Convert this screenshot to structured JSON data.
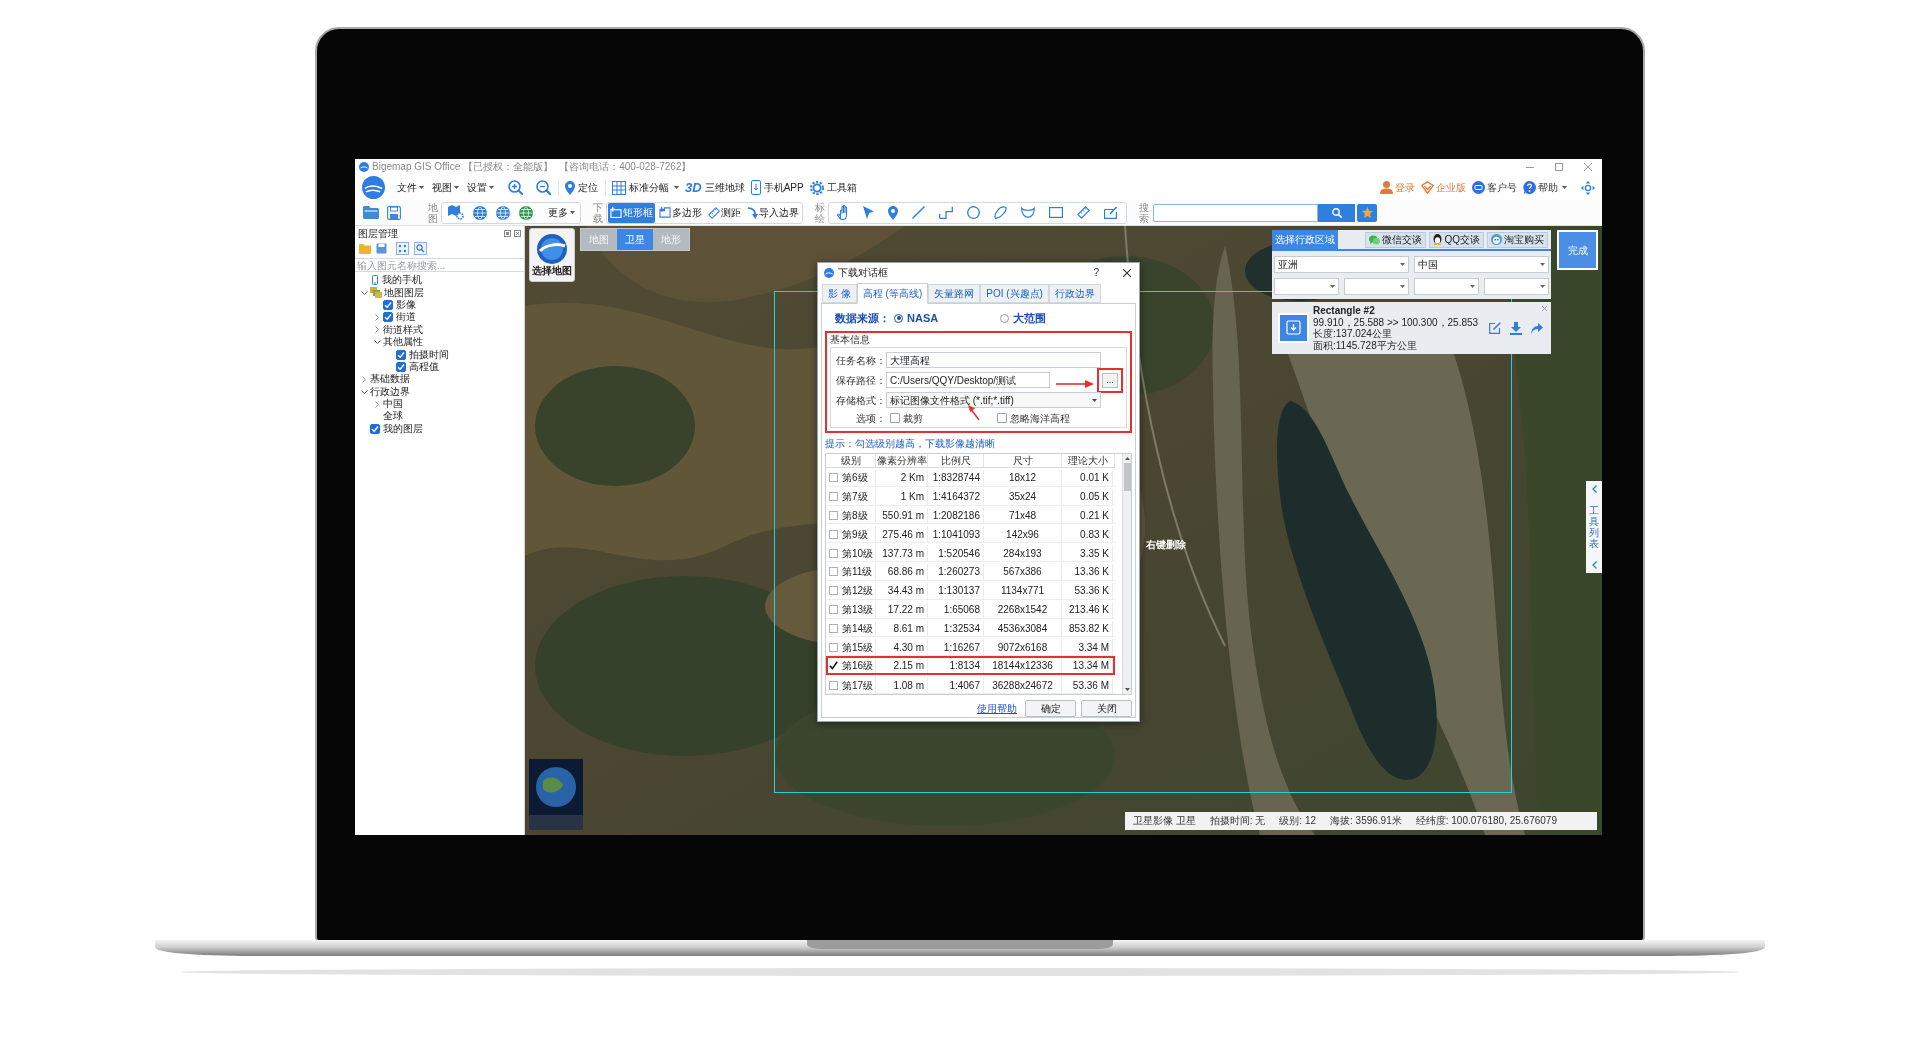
{
  "window": {
    "title": "Bigemap GIS Office",
    "license": "【已授权：全能版】",
    "hotline": "【咨询电话：400-028-7262】"
  },
  "menu_bar": {
    "menus": [
      {
        "label": "文件",
        "dropdown": true
      },
      {
        "label": "视图",
        "dropdown": true
      },
      {
        "label": "设置",
        "dropdown": true
      }
    ],
    "tools": [
      {
        "label": "定位",
        "dropdown": false
      },
      {
        "label": "标准分幅",
        "dropdown": true
      },
      {
        "label": "三维地球",
        "dropdown": false,
        "icon_text": "3D"
      },
      {
        "label": "手机APP",
        "dropdown": false
      },
      {
        "label": "工具箱",
        "dropdown": false
      }
    ],
    "account": [
      {
        "label": "登录",
        "dropdown": false,
        "kind": "accent"
      },
      {
        "label": "企业版",
        "dropdown": false,
        "kind": "accent"
      },
      {
        "label": "客户号",
        "dropdown": false,
        "kind": "plain"
      },
      {
        "label": "帮助",
        "dropdown": true,
        "kind": "plain"
      }
    ]
  },
  "toolbar": {
    "map_group": {
      "label": "地图",
      "more": {
        "label": "更多",
        "dropdown": true
      }
    },
    "download_group": {
      "label": "下载",
      "tools": [
        {
          "label": "矩形框",
          "selected": true
        },
        {
          "label": "多边形",
          "selected": false
        },
        {
          "label": "测距",
          "selected": false
        },
        {
          "label": "导入边界",
          "selected": false
        }
      ]
    },
    "draw_group": {
      "label": "标绘"
    },
    "search_group": {
      "label": "搜索"
    }
  },
  "layer_panel": {
    "title": "图层管理",
    "search": {
      "placeholder": "输入图元名称搜索..."
    },
    "tree": [
      {
        "label": "我的手机",
        "kind": "device"
      },
      {
        "label": "地图图层",
        "kind": "layers",
        "expanded": true,
        "children": [
          {
            "label": "影像",
            "kind": "checkable",
            "checked": true
          },
          {
            "label": "街道",
            "kind": "checkable",
            "checked": true,
            "expanded": false
          },
          {
            "label": "街道样式",
            "kind": "plain",
            "expanded": false
          },
          {
            "label": "其他属性",
            "kind": "plain",
            "expanded": true,
            "children": [
              {
                "label": "拍摄时间",
                "kind": "checkable",
                "checked": true
              },
              {
                "label": "高程值",
                "kind": "checkable",
                "checked": true
              }
            ]
          }
        ]
      },
      {
        "label": "基础数据",
        "kind": "plain",
        "expanded": false
      },
      {
        "label": "行政边界",
        "kind": "plain",
        "expanded": true,
        "children": [
          {
            "label": "中国",
            "kind": "plain",
            "expanded": false
          },
          {
            "label": "全球",
            "kind": "plain"
          }
        ]
      },
      {
        "label": "我的图层",
        "kind": "checkable",
        "checked": true
      }
    ]
  },
  "map": {
    "view_tabs": [
      {
        "label": "地图",
        "selected": false
      },
      {
        "label": "卫星",
        "selected": true
      },
      {
        "label": "地形",
        "selected": false
      }
    ],
    "map_picker": "选择地图",
    "hint": "右键删除",
    "side_tab": "工具列表",
    "region_panel": {
      "tab": "选择行政区域",
      "contacts": [
        "微信交谈",
        "QQ交谈",
        "淘宝购买"
      ],
      "selects": [
        "亚洲",
        "中国"
      ]
    },
    "shape_card": {
      "title": "Rectangle #2",
      "coords": "99.910，25.588 >> 100.300，25.853",
      "length": "长度:137.024公里",
      "area": "面积:1145.728平方公里"
    },
    "done_button": "完成",
    "status_bar": [
      "卫星影像 卫星",
      "拍摄时间: 无",
      "级别: 12",
      "海拔: 3596.91米",
      "经纬度: 100.076180, 25.676079"
    ]
  },
  "download_dialog": {
    "title": "下载对话框",
    "help": "?",
    "tabs": [
      {
        "label": "影 像",
        "selected": false
      },
      {
        "label": "高程 (等高线)",
        "selected": true
      },
      {
        "label": "矢量路网",
        "selected": false
      },
      {
        "label": "POI (兴趣点)",
        "selected": false
      },
      {
        "label": "行政边界",
        "selected": false
      }
    ],
    "source": {
      "label": "数据来源：",
      "options": [
        {
          "label": "NASA",
          "selected": true
        },
        {
          "label": "大范围",
          "selected": false
        }
      ]
    },
    "basic_info": {
      "title": "基本信息",
      "highlighted": true,
      "fields": [
        {
          "kind": "text",
          "label": "任务名称：",
          "value": "大理高程"
        },
        {
          "kind": "path",
          "label": "保存路径：",
          "value": "C:/Users/QQY/Desktop/测试",
          "button": "...",
          "highlighted": true
        },
        {
          "kind": "select",
          "label": "存储格式：",
          "value": "标记图像文件格式 (*.tif;*.tiff)"
        }
      ],
      "options_label": "选项：",
      "options": [
        {
          "label": "裁剪",
          "checked": false
        },
        {
          "label": "忽略海洋高程",
          "checked": false
        }
      ]
    },
    "tip": "提示：勾选级别越高，下载影像越清晰",
    "levels": {
      "columns": [
        "级别",
        "像素分辨率",
        "比例尺",
        "尺寸",
        "理论大小"
      ],
      "rows": [
        {
          "checked": false,
          "highlighted": false,
          "cells": [
            "第6级",
            "2 Km",
            "1:8328744",
            "18x12",
            "0.01 K"
          ]
        },
        {
          "checked": false,
          "highlighted": false,
          "cells": [
            "第7级",
            "1 Km",
            "1:4164372",
            "35x24",
            "0.05 K"
          ]
        },
        {
          "checked": false,
          "highlighted": false,
          "cells": [
            "第8级",
            "550.91 m",
            "1:2082186",
            "71x48",
            "0.21 K"
          ]
        },
        {
          "checked": false,
          "highlighted": false,
          "cells": [
            "第9级",
            "275.46 m",
            "1:1041093",
            "142x96",
            "0.83 K"
          ]
        },
        {
          "checked": false,
          "highlighted": false,
          "cells": [
            "第10级",
            "137.73 m",
            "1:520546",
            "284x193",
            "3.35 K"
          ]
        },
        {
          "checked": false,
          "highlighted": false,
          "cells": [
            "第11级",
            "68.86 m",
            "1:260273",
            "567x386",
            "13.36 K"
          ]
        },
        {
          "checked": false,
          "highlighted": false,
          "cells": [
            "第12级",
            "34.43 m",
            "1:130137",
            "1134x771",
            "53.36 K"
          ]
        },
        {
          "checked": false,
          "highlighted": false,
          "cells": [
            "第13级",
            "17.22 m",
            "1:65068",
            "2268x1542",
            "213.46 K"
          ]
        },
        {
          "checked": false,
          "highlighted": false,
          "cells": [
            "第14级",
            "8.61 m",
            "1:32534",
            "4536x3084",
            "853.82 K"
          ]
        },
        {
          "checked": false,
          "highlighted": false,
          "cells": [
            "第15级",
            "4.30 m",
            "1:16267",
            "9072x6168",
            "3.34 M"
          ]
        },
        {
          "checked": true,
          "highlighted": true,
          "cells": [
            "第16级",
            "2.15 m",
            "1:8134",
            "18144x12336",
            "13.34 M"
          ]
        },
        {
          "checked": false,
          "highlighted": false,
          "cells": [
            "第17级",
            "1.08 m",
            "1:4067",
            "36288x24672",
            "53.36 M"
          ]
        }
      ]
    },
    "help_link": "使用帮助",
    "buttons": [
      "确定",
      "关闭"
    ]
  }
}
